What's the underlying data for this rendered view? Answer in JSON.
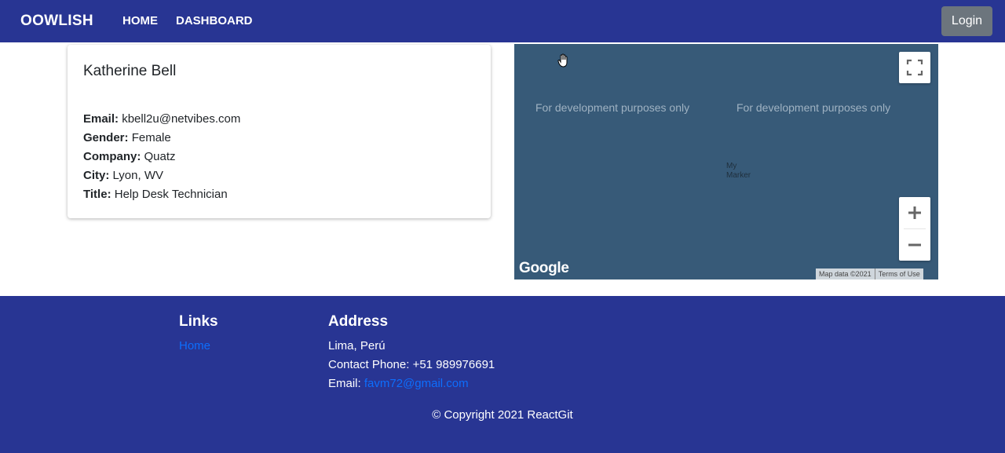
{
  "nav": {
    "brand": "OOWLISH",
    "links": [
      "HOME",
      "DASHBOARD"
    ],
    "login": "Login"
  },
  "profile": {
    "name": "Katherine Bell",
    "fields": [
      {
        "label": "Email:",
        "value": "kbell2u@netvibes.com"
      },
      {
        "label": "Gender:",
        "value": "Female"
      },
      {
        "label": "Company:",
        "value": "Quatz"
      },
      {
        "label": "City:",
        "value": "Lyon, WV"
      },
      {
        "label": "Title:",
        "value": "Help Desk Technician"
      }
    ]
  },
  "map": {
    "dev_notice": "For development purposes only",
    "marker_label": "My Marker",
    "logo": "Google",
    "attribution": "Map data ©2021",
    "terms": "Terms of Use",
    "zoom_in": "+",
    "zoom_out": "−",
    "water_color": "#375a78"
  },
  "footer": {
    "links_heading": "Links",
    "home_link": "Home",
    "address_heading": "Address",
    "location": "Lima, Perú",
    "phone": "Contact Phone: +51 989976691",
    "email_label": "Email:",
    "email": "favm72@gmail.com",
    "copyright": "© Copyright 2021 ReactGit"
  },
  "colors": {
    "primary": "#283593",
    "link": "#0d6efd",
    "button": "#6c757d"
  }
}
